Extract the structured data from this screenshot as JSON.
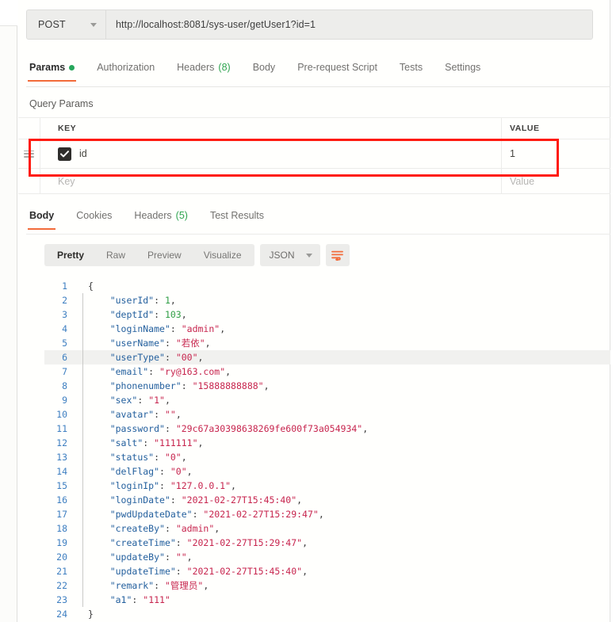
{
  "request": {
    "method": "POST",
    "method_caret_icon": "chevron-down-icon",
    "url": "http://localhost:8081/sys-user/getUser1?id=1",
    "tabs": [
      {
        "label": "Params",
        "badge": "",
        "dot": true,
        "active": true
      },
      {
        "label": "Authorization",
        "badge": "",
        "dot": false,
        "active": false
      },
      {
        "label": "Headers",
        "badge": "(8)",
        "dot": false,
        "active": false
      },
      {
        "label": "Body",
        "badge": "",
        "dot": false,
        "active": false
      },
      {
        "label": "Pre-request Script",
        "badge": "",
        "dot": false,
        "active": false
      },
      {
        "label": "Tests",
        "badge": "",
        "dot": false,
        "active": false
      },
      {
        "label": "Settings",
        "badge": "",
        "dot": false,
        "active": false
      }
    ]
  },
  "query_params": {
    "section_title": "Query Params",
    "columns": {
      "key": "KEY",
      "value": "VALUE"
    },
    "rows": [
      {
        "checked": true,
        "key": "id",
        "value": "1",
        "placeholder": false
      },
      {
        "checked": false,
        "key": "Key",
        "value": "Value",
        "placeholder": true
      }
    ],
    "drag_handle_icon": "drag-handle-icon",
    "checkbox_icon": "checkmark-icon"
  },
  "response": {
    "tabs": [
      {
        "label": "Body",
        "badge": "",
        "active": true
      },
      {
        "label": "Cookies",
        "badge": "",
        "active": false
      },
      {
        "label": "Headers",
        "badge": "(5)",
        "active": false
      },
      {
        "label": "Test Results",
        "badge": "",
        "active": false
      }
    ],
    "view_modes": [
      {
        "label": "Pretty",
        "active": true
      },
      {
        "label": "Raw",
        "active": false
      },
      {
        "label": "Preview",
        "active": false
      },
      {
        "label": "Visualize",
        "active": false
      }
    ],
    "format": "JSON",
    "format_caret_icon": "chevron-down-icon",
    "wrap_button_icon": "text-wrap-icon",
    "wrap_button_color": "#f26b3a"
  },
  "body_code": {
    "highlighted_line": 6,
    "lines": [
      {
        "no": "1",
        "indent": 0,
        "fold": false,
        "tokens": [
          {
            "t": "p",
            "v": "{"
          }
        ]
      },
      {
        "no": "2",
        "indent": 1,
        "fold": true,
        "tokens": [
          {
            "t": "k",
            "v": "\"userId\""
          },
          {
            "t": "p",
            "v": ": "
          },
          {
            "t": "n",
            "v": "1"
          },
          {
            "t": "p",
            "v": ","
          }
        ]
      },
      {
        "no": "3",
        "indent": 1,
        "fold": true,
        "tokens": [
          {
            "t": "k",
            "v": "\"deptId\""
          },
          {
            "t": "p",
            "v": ": "
          },
          {
            "t": "n",
            "v": "103"
          },
          {
            "t": "p",
            "v": ","
          }
        ]
      },
      {
        "no": "4",
        "indent": 1,
        "fold": true,
        "tokens": [
          {
            "t": "k",
            "v": "\"loginName\""
          },
          {
            "t": "p",
            "v": ": "
          },
          {
            "t": "s",
            "v": "\"admin\""
          },
          {
            "t": "p",
            "v": ","
          }
        ]
      },
      {
        "no": "5",
        "indent": 1,
        "fold": true,
        "tokens": [
          {
            "t": "k",
            "v": "\"userName\""
          },
          {
            "t": "p",
            "v": ": "
          },
          {
            "t": "s",
            "v": "\"若依\""
          },
          {
            "t": "p",
            "v": ","
          }
        ]
      },
      {
        "no": "6",
        "indent": 1,
        "fold": true,
        "tokens": [
          {
            "t": "k",
            "v": "\"userType\""
          },
          {
            "t": "p",
            "v": ": "
          },
          {
            "t": "s",
            "v": "\"00\""
          },
          {
            "t": "p",
            "v": ","
          }
        ]
      },
      {
        "no": "7",
        "indent": 1,
        "fold": true,
        "tokens": [
          {
            "t": "k",
            "v": "\"email\""
          },
          {
            "t": "p",
            "v": ": "
          },
          {
            "t": "s",
            "v": "\"ry@163.com\""
          },
          {
            "t": "p",
            "v": ","
          }
        ]
      },
      {
        "no": "8",
        "indent": 1,
        "fold": true,
        "tokens": [
          {
            "t": "k",
            "v": "\"phonenumber\""
          },
          {
            "t": "p",
            "v": ": "
          },
          {
            "t": "s",
            "v": "\"15888888888\""
          },
          {
            "t": "p",
            "v": ","
          }
        ]
      },
      {
        "no": "9",
        "indent": 1,
        "fold": true,
        "tokens": [
          {
            "t": "k",
            "v": "\"sex\""
          },
          {
            "t": "p",
            "v": ": "
          },
          {
            "t": "s",
            "v": "\"1\""
          },
          {
            "t": "p",
            "v": ","
          }
        ]
      },
      {
        "no": "10",
        "indent": 1,
        "fold": true,
        "tokens": [
          {
            "t": "k",
            "v": "\"avatar\""
          },
          {
            "t": "p",
            "v": ": "
          },
          {
            "t": "s",
            "v": "\"\""
          },
          {
            "t": "p",
            "v": ","
          }
        ]
      },
      {
        "no": "11",
        "indent": 1,
        "fold": true,
        "tokens": [
          {
            "t": "k",
            "v": "\"password\""
          },
          {
            "t": "p",
            "v": ": "
          },
          {
            "t": "s",
            "v": "\"29c67a30398638269fe600f73a054934\""
          },
          {
            "t": "p",
            "v": ","
          }
        ]
      },
      {
        "no": "12",
        "indent": 1,
        "fold": true,
        "tokens": [
          {
            "t": "k",
            "v": "\"salt\""
          },
          {
            "t": "p",
            "v": ": "
          },
          {
            "t": "s",
            "v": "\"111111\""
          },
          {
            "t": "p",
            "v": ","
          }
        ]
      },
      {
        "no": "13",
        "indent": 1,
        "fold": true,
        "tokens": [
          {
            "t": "k",
            "v": "\"status\""
          },
          {
            "t": "p",
            "v": ": "
          },
          {
            "t": "s",
            "v": "\"0\""
          },
          {
            "t": "p",
            "v": ","
          }
        ]
      },
      {
        "no": "14",
        "indent": 1,
        "fold": true,
        "tokens": [
          {
            "t": "k",
            "v": "\"delFlag\""
          },
          {
            "t": "p",
            "v": ": "
          },
          {
            "t": "s",
            "v": "\"0\""
          },
          {
            "t": "p",
            "v": ","
          }
        ]
      },
      {
        "no": "15",
        "indent": 1,
        "fold": true,
        "tokens": [
          {
            "t": "k",
            "v": "\"loginIp\""
          },
          {
            "t": "p",
            "v": ": "
          },
          {
            "t": "s",
            "v": "\"127.0.0.1\""
          },
          {
            "t": "p",
            "v": ","
          }
        ]
      },
      {
        "no": "16",
        "indent": 1,
        "fold": true,
        "tokens": [
          {
            "t": "k",
            "v": "\"loginDate\""
          },
          {
            "t": "p",
            "v": ": "
          },
          {
            "t": "s",
            "v": "\"2021-02-27T15:45:40\""
          },
          {
            "t": "p",
            "v": ","
          }
        ]
      },
      {
        "no": "17",
        "indent": 1,
        "fold": true,
        "tokens": [
          {
            "t": "k",
            "v": "\"pwdUpdateDate\""
          },
          {
            "t": "p",
            "v": ": "
          },
          {
            "t": "s",
            "v": "\"2021-02-27T15:29:47\""
          },
          {
            "t": "p",
            "v": ","
          }
        ]
      },
      {
        "no": "18",
        "indent": 1,
        "fold": true,
        "tokens": [
          {
            "t": "k",
            "v": "\"createBy\""
          },
          {
            "t": "p",
            "v": ": "
          },
          {
            "t": "s",
            "v": "\"admin\""
          },
          {
            "t": "p",
            "v": ","
          }
        ]
      },
      {
        "no": "19",
        "indent": 1,
        "fold": true,
        "tokens": [
          {
            "t": "k",
            "v": "\"createTime\""
          },
          {
            "t": "p",
            "v": ": "
          },
          {
            "t": "s",
            "v": "\"2021-02-27T15:29:47\""
          },
          {
            "t": "p",
            "v": ","
          }
        ]
      },
      {
        "no": "20",
        "indent": 1,
        "fold": true,
        "tokens": [
          {
            "t": "k",
            "v": "\"updateBy\""
          },
          {
            "t": "p",
            "v": ": "
          },
          {
            "t": "s",
            "v": "\"\""
          },
          {
            "t": "p",
            "v": ","
          }
        ]
      },
      {
        "no": "21",
        "indent": 1,
        "fold": true,
        "tokens": [
          {
            "t": "k",
            "v": "\"updateTime\""
          },
          {
            "t": "p",
            "v": ": "
          },
          {
            "t": "s",
            "v": "\"2021-02-27T15:45:40\""
          },
          {
            "t": "p",
            "v": ","
          }
        ]
      },
      {
        "no": "22",
        "indent": 1,
        "fold": true,
        "tokens": [
          {
            "t": "k",
            "v": "\"remark\""
          },
          {
            "t": "p",
            "v": ": "
          },
          {
            "t": "s",
            "v": "\"管理员\""
          },
          {
            "t": "p",
            "v": ","
          }
        ]
      },
      {
        "no": "23",
        "indent": 1,
        "fold": true,
        "tokens": [
          {
            "t": "k",
            "v": "\"a1\""
          },
          {
            "t": "p",
            "v": ": "
          },
          {
            "t": "s",
            "v": "\"111\""
          }
        ]
      },
      {
        "no": "24",
        "indent": 0,
        "fold": false,
        "tokens": [
          {
            "t": "p",
            "v": "}"
          }
        ]
      }
    ]
  },
  "annotation": {
    "highlight_box_color": "#ff1b0e"
  }
}
